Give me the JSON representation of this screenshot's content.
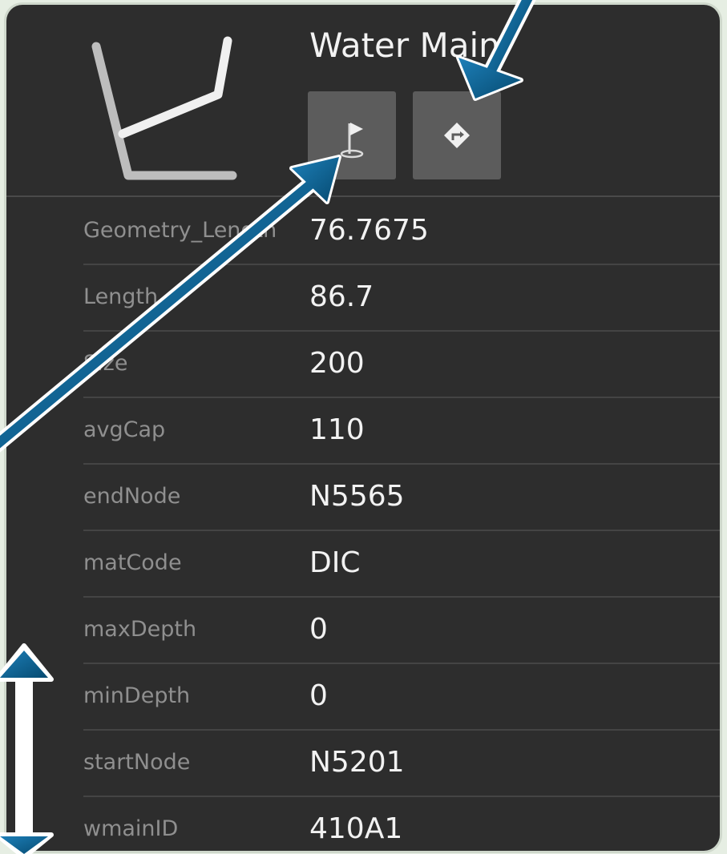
{
  "header": {
    "title": "Water Main",
    "thumbnail_icon": "polyline-shape-icon",
    "buttons": [
      {
        "icon": "flag-icon"
      },
      {
        "icon": "directions-icon"
      }
    ]
  },
  "attributes": [
    {
      "key": "Geometry_Length",
      "value": "76.7675"
    },
    {
      "key": "Length",
      "value": "86.7"
    },
    {
      "key": "Size",
      "value": "200"
    },
    {
      "key": "avgCap",
      "value": "110"
    },
    {
      "key": "endNode",
      "value": "N5565"
    },
    {
      "key": "matCode",
      "value": "DIC"
    },
    {
      "key": "maxDepth",
      "value": "0"
    },
    {
      "key": "minDepth",
      "value": "0"
    },
    {
      "key": "startNode",
      "value": "N5201"
    },
    {
      "key": "wmainID",
      "value": "410A1"
    }
  ],
  "colors": {
    "panel_background": "#2d2d2d",
    "button_background": "#5c5c5c",
    "annotation_arrow": "#0b5a86"
  }
}
